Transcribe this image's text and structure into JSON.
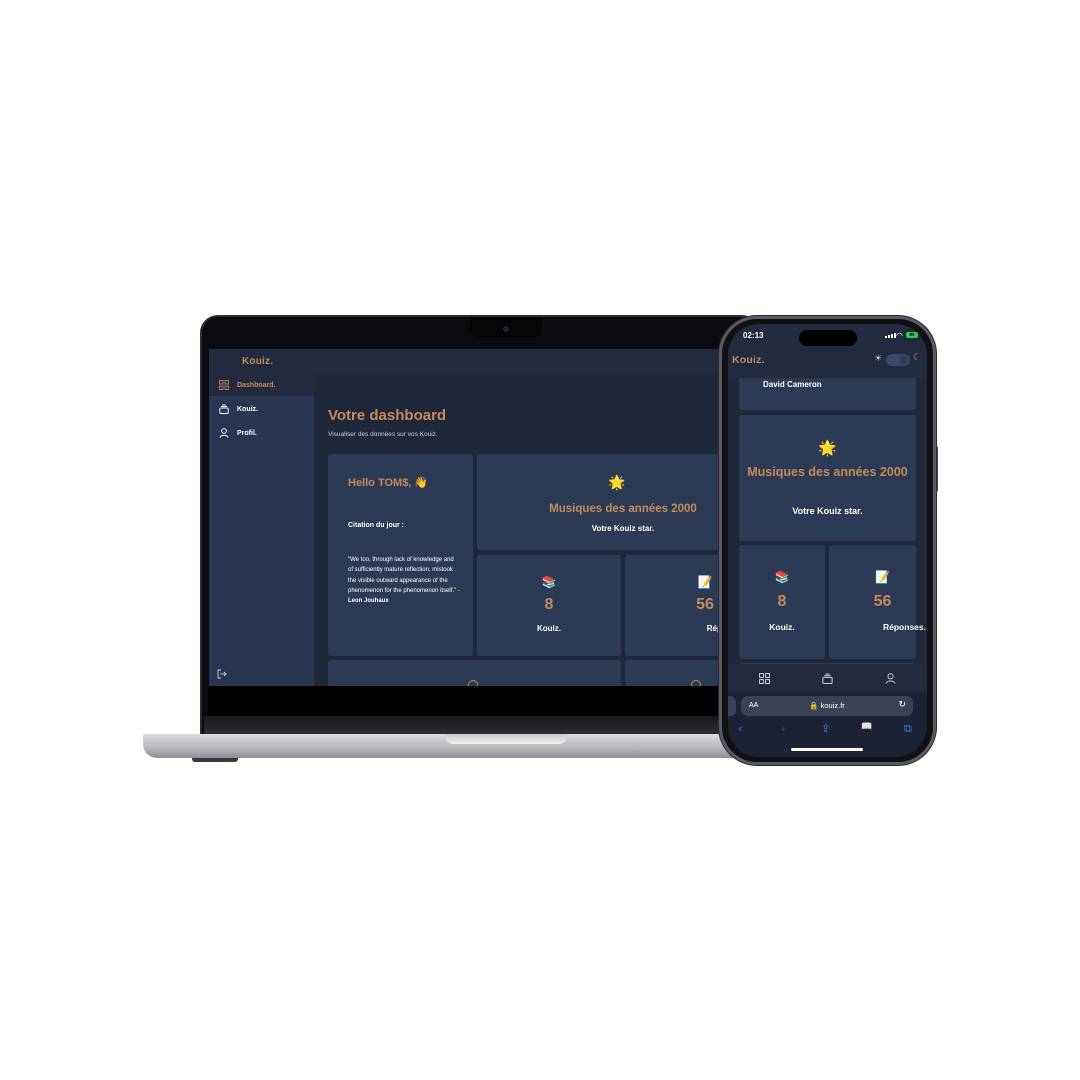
{
  "desktop": {
    "brand": "Kouiz.",
    "sidebar": {
      "items": [
        {
          "label": "Dashboard.",
          "icon": "grid-icon",
          "active": true
        },
        {
          "label": "Kouiz.",
          "icon": "stack-icon",
          "active": false
        },
        {
          "label": "Profil.",
          "icon": "user-icon",
          "active": false
        }
      ],
      "logout_icon": "logout-icon"
    },
    "main": {
      "title": "Votre dashboard",
      "subtitle": "Visualiser des données sur vos Kouiz."
    },
    "hello_card": {
      "greeting": "Hello TOM$, 👋",
      "citation_title": "Citation du jour :",
      "quote": "\"We too, through lack of knowledge and of sufficiently mature reflection, mistook the visible outward appearance of the phenomenon for the phenomenon itself.\" - ",
      "author": "Leon Jouhaux"
    },
    "star_card": {
      "emoji": "🌟",
      "title": "Musiques des années 2000",
      "subtitle": "Votre Kouiz star."
    },
    "stats": [
      {
        "emoji": "📚",
        "value": "8",
        "label": "Kouiz."
      },
      {
        "emoji": "📝",
        "value": "56",
        "label": "Réponses."
      }
    ]
  },
  "mobile": {
    "status": {
      "time": "02:13",
      "battery": "80"
    },
    "brand": "Kouiz.",
    "theme_toggle": {
      "sun_icon": "sun-icon",
      "moon_icon": "moon-icon"
    },
    "quote_author": "David Cameron",
    "star_card": {
      "emoji": "🌟",
      "title": "Musiques des années 2000",
      "subtitle": "Votre Kouiz star."
    },
    "stats": [
      {
        "emoji": "📚",
        "value": "8",
        "label": "Kouiz."
      },
      {
        "emoji": "📝",
        "value": "56",
        "label": "Réponses."
      }
    ],
    "tabbar": [
      "grid-icon",
      "stack-icon",
      "user-icon"
    ],
    "safari": {
      "aa": "AA",
      "url": "🔒 kouiz.fr",
      "reload": "↻",
      "back": "‹",
      "forward": "›",
      "share": "⇪",
      "bookmarks": "📖",
      "tabs": "⧉"
    }
  },
  "colors": {
    "accent": "#c18a5b",
    "background": "#1f2839",
    "card": "#2d3a54",
    "sidebar": "#2a3550"
  }
}
